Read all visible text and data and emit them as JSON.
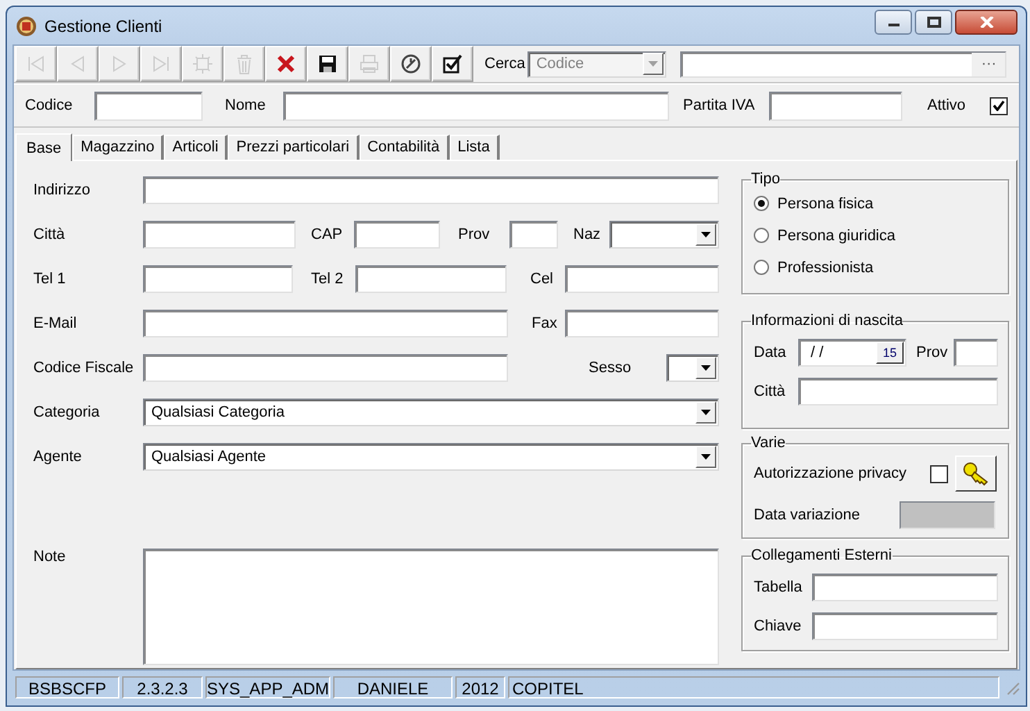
{
  "window": {
    "title": "Gestione Clienti"
  },
  "toolbar": {
    "buttons": [
      {
        "kind": "first",
        "disabled": true
      },
      {
        "kind": "prev",
        "disabled": true
      },
      {
        "kind": "next",
        "disabled": true
      },
      {
        "kind": "last",
        "disabled": true
      },
      {
        "kind": "new",
        "disabled": true
      },
      {
        "kind": "delete",
        "disabled": true
      },
      {
        "kind": "cancel",
        "disabled": false
      },
      {
        "kind": "save",
        "disabled": false
      },
      {
        "kind": "print",
        "disabled": true
      },
      {
        "kind": "tool",
        "disabled": false
      },
      {
        "kind": "confirm",
        "disabled": false
      }
    ],
    "search": {
      "label": "Cerca",
      "mode": {
        "value": "Codice",
        "disabled": true
      },
      "browse_button": "···"
    }
  },
  "header": [
    {
      "label": "Codice",
      "kind": "text"
    },
    {
      "label": "Nome",
      "kind": "text"
    },
    {
      "label": "Partita IVA",
      "kind": "text"
    },
    {
      "label": "Attivo",
      "kind": "checkbox",
      "checked": true
    }
  ],
  "tabs": [
    {
      "label": "Base",
      "selected": true
    },
    {
      "label": "Magazzino",
      "selected": false
    },
    {
      "label": "Articoli",
      "selected": false
    },
    {
      "label": "Prezzi particolari",
      "selected": false
    },
    {
      "label": "Contabilità",
      "selected": false
    },
    {
      "label": "Lista",
      "selected": false
    }
  ],
  "form": {
    "rows": [
      [
        {
          "label": "Indirizzo",
          "kind": "text"
        }
      ],
      [
        {
          "label": "Città",
          "kind": "text"
        },
        {
          "label": "CAP",
          "kind": "text"
        },
        {
          "label": "Prov",
          "kind": "text"
        },
        {
          "label": "Naz",
          "kind": "combo"
        }
      ],
      [
        {
          "label": "Tel 1",
          "kind": "text"
        },
        {
          "label": "Tel 2",
          "kind": "text"
        },
        {
          "label": "Cel",
          "kind": "text"
        }
      ],
      [
        {
          "label": "E-Mail",
          "kind": "text"
        },
        {
          "label": "Fax",
          "kind": "text"
        }
      ],
      [
        {
          "label": "Codice Fiscale",
          "kind": "text"
        },
        {
          "label": "Sesso",
          "kind": "combo"
        }
      ],
      [
        {
          "label": "Categoria",
          "kind": "combo",
          "value": "Qualsiasi Categoria"
        }
      ],
      [
        {
          "label": "Agente",
          "kind": "combo",
          "value": "Qualsiasi Agente"
        }
      ]
    ],
    "note": {
      "label": "Note"
    }
  },
  "groups": [
    {
      "title": "Tipo",
      "kind": "radios",
      "options": [
        {
          "label": "Persona fisica",
          "selected": true
        },
        {
          "label": "Persona giuridica",
          "selected": false
        },
        {
          "label": "Professionista",
          "selected": false
        }
      ]
    },
    {
      "title": "Informazioni di nascita",
      "kind": "form",
      "rows": [
        [
          {
            "label": "Data",
            "kind": "date",
            "value": "/ /",
            "button": "15"
          },
          {
            "label": "Prov",
            "kind": "text"
          }
        ],
        [
          {
            "label": "Città",
            "kind": "text"
          }
        ]
      ]
    },
    {
      "title": "Varie",
      "kind": "form",
      "rows": [
        [
          {
            "label": "Autorizzazione privacy",
            "kind": "checkbox",
            "checked": false
          },
          {
            "kind": "key_button"
          }
        ],
        [
          {
            "label": "Data variazione",
            "kind": "readonly"
          }
        ]
      ]
    },
    {
      "title": "Collegamenti Esterni",
      "kind": "form",
      "rows": [
        [
          {
            "label": "Tabella",
            "kind": "text"
          }
        ],
        [
          {
            "label": "Chiave",
            "kind": "text"
          }
        ]
      ]
    }
  ],
  "status_bar": [
    "BSBSCFP",
    "2.3.2.3",
    "SYS_APP_ADM",
    "DANIELE",
    "2012",
    "COPITEL"
  ]
}
